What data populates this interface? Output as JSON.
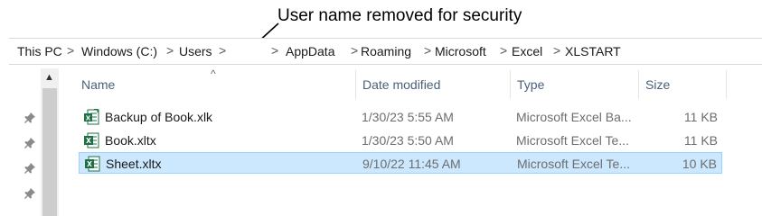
{
  "annotation": {
    "text": "User name removed for security"
  },
  "breadcrumb": {
    "items": [
      "This PC",
      "Windows (C:)",
      "Users",
      "",
      "AppData",
      "Roaming",
      "Microsoft",
      "Excel",
      "XLSTART"
    ],
    "separator": ">"
  },
  "columns": {
    "name": "Name",
    "date": "Date modified",
    "type": "Type",
    "size": "Size"
  },
  "files": [
    {
      "name": "Backup of Book.xlk",
      "date": "1/30/23 5:55 AM",
      "type": "Microsoft Excel Ba...",
      "size": "11 KB",
      "icon": "excel-backup-icon",
      "selected": false
    },
    {
      "name": "Book.xltx",
      "date": "1/30/23 5:50 AM",
      "type": "Microsoft Excel Te...",
      "size": "11 KB",
      "icon": "excel-template-icon",
      "selected": false
    },
    {
      "name": "Sheet.xltx",
      "date": "9/10/22 11:45 AM",
      "type": "Microsoft Excel Te...",
      "size": "10 KB",
      "icon": "excel-template-icon",
      "selected": true
    }
  ],
  "colors": {
    "selection": "#cce8ff",
    "selection_border": "#99d1ff",
    "header_text": "#4c607a",
    "excel_green": "#1e7145"
  }
}
